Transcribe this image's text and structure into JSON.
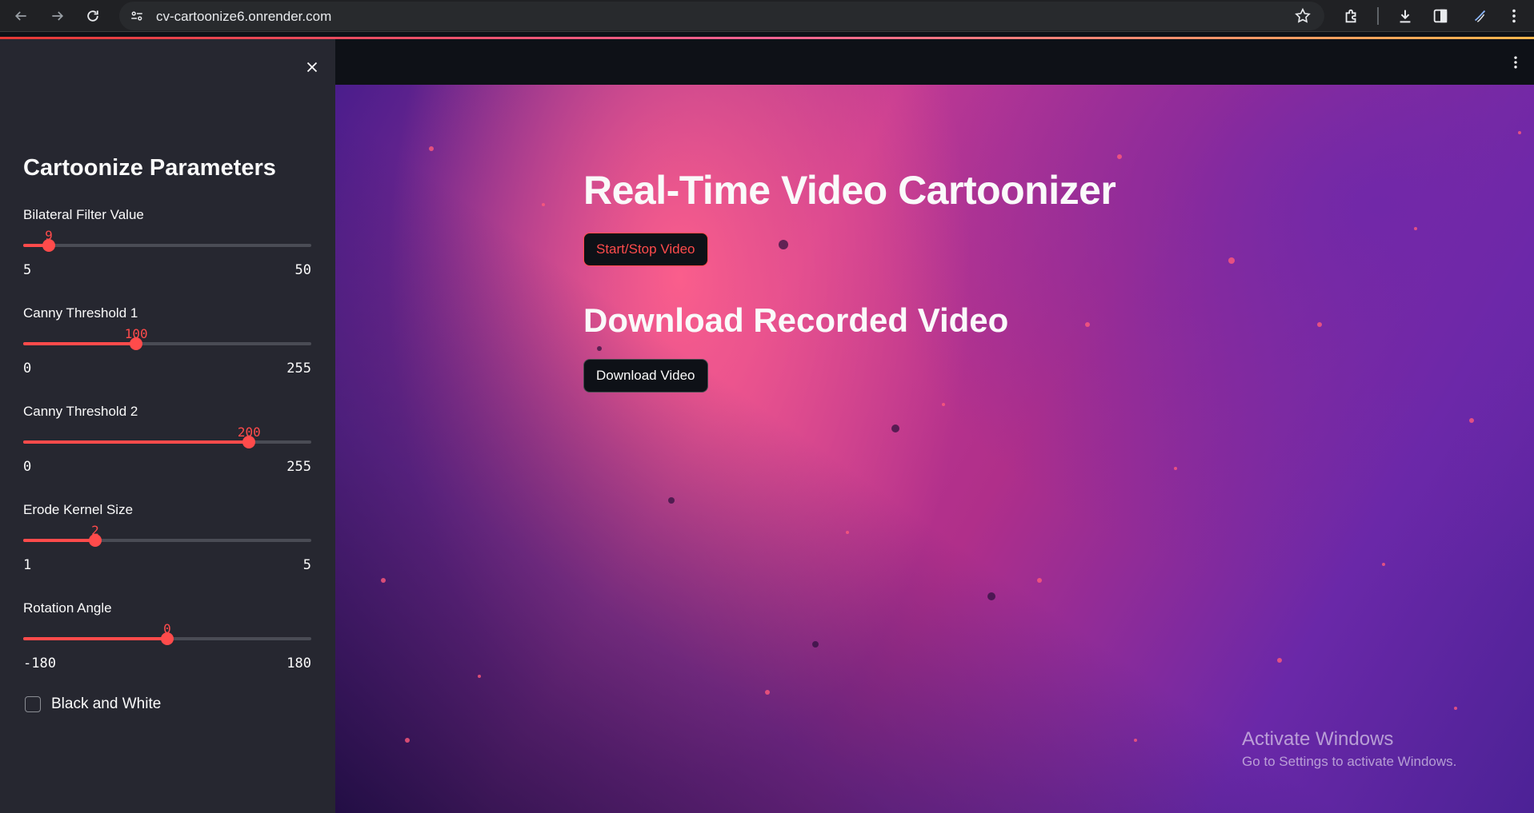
{
  "browser": {
    "url": "cv-cartoonize6.onrender.com"
  },
  "sidebar": {
    "title": "Cartoonize Parameters",
    "sliders": [
      {
        "label": "Bilateral Filter Value",
        "value": 9,
        "min": 5,
        "max": 50
      },
      {
        "label": "Canny Threshold 1",
        "value": 100,
        "min": 0,
        "max": 255
      },
      {
        "label": "Canny Threshold 2",
        "value": 200,
        "min": 0,
        "max": 255
      },
      {
        "label": "Erode Kernel Size",
        "value": 2,
        "min": 1,
        "max": 5
      },
      {
        "label": "Rotation Angle",
        "value": 0,
        "min": -180,
        "max": 180
      }
    ],
    "checkbox": {
      "label": "Black and White",
      "checked": false
    }
  },
  "main": {
    "title": "Real-Time Video Cartoonizer",
    "start_button": "Start/Stop Video",
    "download_title": "Download Recorded Video",
    "download_button": "Download Video"
  },
  "watermark": {
    "title": "Activate Windows",
    "subtitle": "Go to Settings to activate Windows."
  },
  "colors": {
    "accent": "#ff4b4b",
    "sidebar_bg": "#262730",
    "app_bg": "#0e1117",
    "text": "#fafafa"
  }
}
